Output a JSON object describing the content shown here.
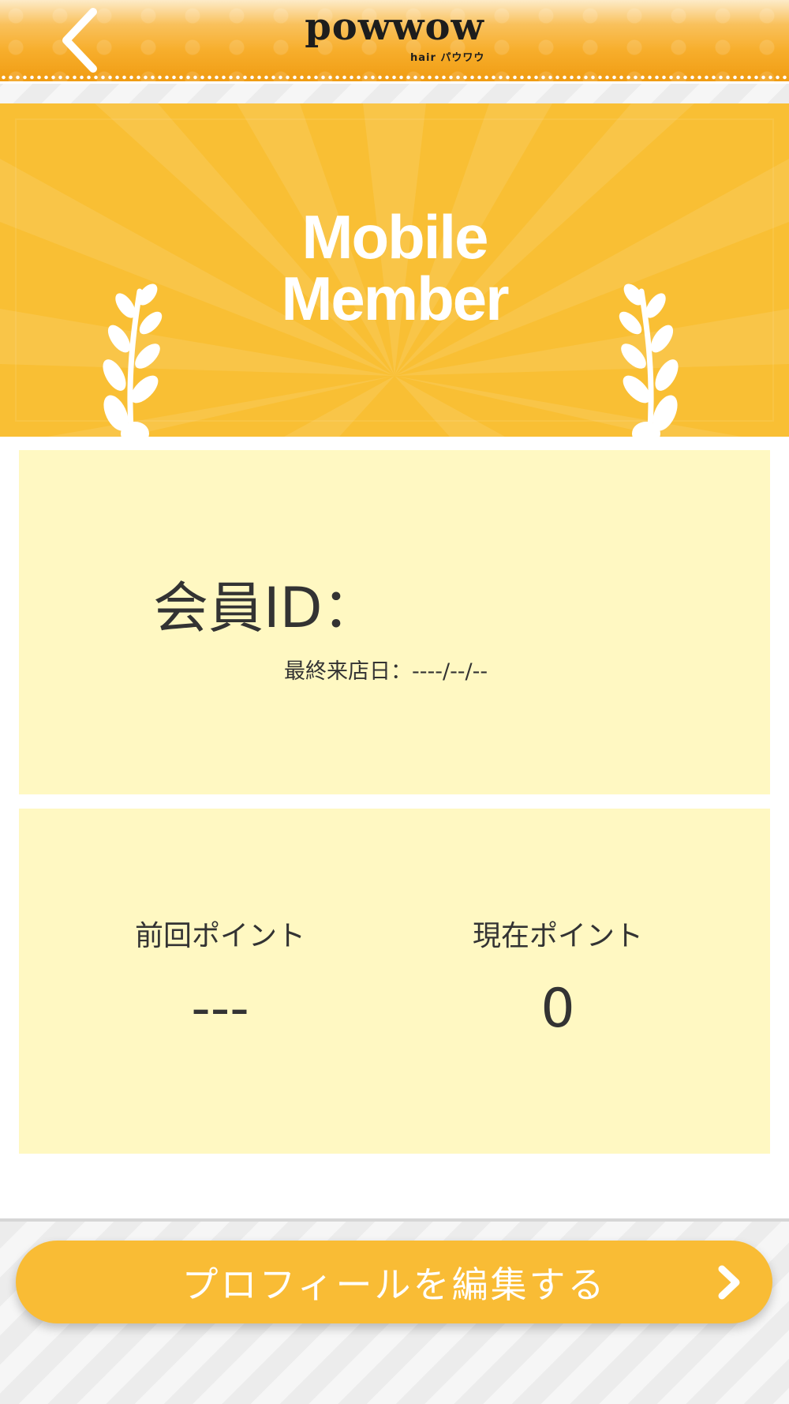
{
  "header": {
    "logo_text": "powwow",
    "logo_sub": "hair パウワウ"
  },
  "banner": {
    "title_line1": "Mobile",
    "title_line2": "Member"
  },
  "member_card": {
    "id_label": "会員ID：",
    "last_visit": "最終来店日：----/--/--"
  },
  "points": {
    "previous_label": "前回ポイント",
    "previous_value": "---",
    "current_label": "現在ポイント",
    "current_value": "0"
  },
  "edit_profile": {
    "label": "プロフィールを編集する"
  },
  "colors": {
    "header_orange": "#f7ae2c",
    "banner_yellow": "#f9bf34",
    "card_cream": "#fff8c2",
    "button_yellow": "#f9bc35",
    "text_dark": "#333333"
  },
  "icons": {
    "back": "chevron-left-icon",
    "laurel": "laurel-icon",
    "forward": "chevron-right-icon"
  }
}
